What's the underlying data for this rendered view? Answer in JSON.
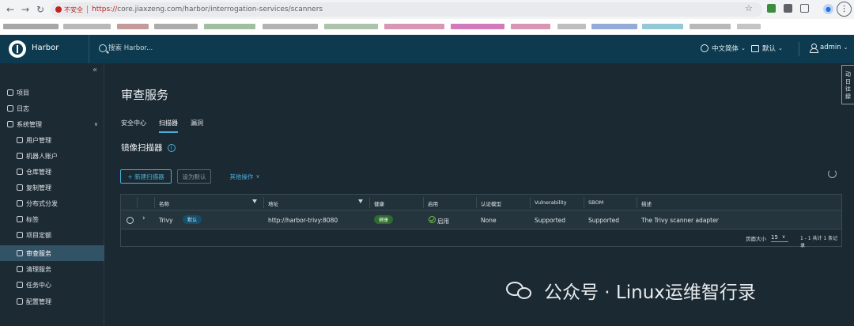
{
  "browser": {
    "insecure_label": "不安全",
    "url_scheme": "https://",
    "url_rest": "core.jiaxzeng.com/harbor/interrogation-services/scanners"
  },
  "header": {
    "brand": "Harbor",
    "search_placeholder": "搜索 Harbor...",
    "language": "中文简体",
    "datetime_format": "默认",
    "user": "admin"
  },
  "sidebar": {
    "items": [
      {
        "label": "项目"
      },
      {
        "label": "日志"
      },
      {
        "label": "系统管理"
      },
      {
        "label": "用户管理"
      },
      {
        "label": "机器人账户"
      },
      {
        "label": "仓库管理"
      },
      {
        "label": "复制管理"
      },
      {
        "label": "分布式分发"
      },
      {
        "label": "标签"
      },
      {
        "label": "项目定额"
      },
      {
        "label": "审查服务"
      },
      {
        "label": "清理服务"
      },
      {
        "label": "任务中心"
      },
      {
        "label": "配置管理"
      }
    ]
  },
  "main": {
    "title": "审查服务",
    "tabs": [
      "安全中心",
      "扫描器",
      "漏洞"
    ],
    "section_title": "镜像扫描器",
    "buttons": {
      "new": "+ 新建扫描器",
      "set_default": "设为默认",
      "more": "其他操作"
    },
    "table": {
      "columns": [
        "名称",
        "地址",
        "健康",
        "启用",
        "认证模型",
        "Vulnerability",
        "SBOM",
        "描述"
      ],
      "rows": [
        {
          "name": "Trivy",
          "default_badge": "默认",
          "url": "http://harbor-trivy:8080",
          "health": "健康",
          "enabled": "启用",
          "auth": "None",
          "vulnerability": "Supported",
          "sbom": "Supported",
          "description": "The Trivy scanner adapter"
        }
      ],
      "page_size_label": "页面大小",
      "page_size": "15",
      "summary": "1 - 1 共计 1 条记录"
    }
  },
  "float_tab": "动 日 往 録",
  "watermark": "公众号 · Linux运维智行录"
}
